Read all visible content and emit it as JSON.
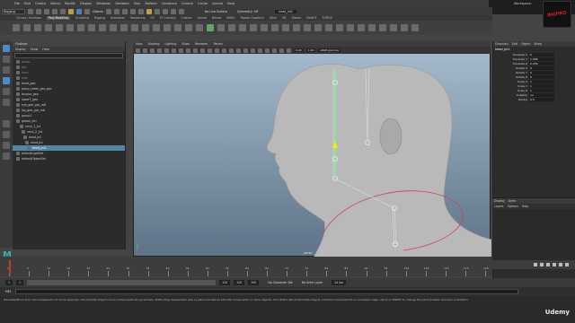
{
  "menu": [
    "File",
    "Edit",
    "Create",
    "Select",
    "Modify",
    "Display",
    "Windows",
    "Skeleton",
    "Skin",
    "Deform",
    "Constrain",
    "Control",
    "Cache",
    "Arnold",
    "Help"
  ],
  "status": {
    "mode": "Rigging",
    "objects_label": "Objects",
    "live_surface": "No Live Surface",
    "symmetry": "Symmetry: Off",
    "object_field": "head_jnt1",
    "workspace": "Workspace:"
  },
  "shelf_tabs": [
    "Curves / Surfaces",
    "Poly Modeling",
    "Sculpting",
    "Rigging",
    "Animation",
    "Rendering",
    "FX",
    "FX Caching",
    "Custom",
    "Arnold",
    "Bifrost",
    "MASH",
    "Motion Graphics",
    "XGen",
    "VR",
    "Stereo",
    "FieldFX",
    "TURTLE"
  ],
  "active_shelf_tab": "Poly Modeling",
  "outliner": {
    "title": "Outliner",
    "menu": [
      "Display",
      "Show",
      "Help"
    ],
    "rows": [
      {
        "label": "persp",
        "dim": true
      },
      {
        "label": "top",
        "dim": true
      },
      {
        "label": "front",
        "dim": true
      },
      {
        "label": "side",
        "dim": true
      },
      {
        "label": "head_geo",
        "dim": false
      },
      {
        "label": "proxy_teeth_geo_grp",
        "dim": false
      },
      {
        "label": "tongue_geo",
        "dim": false
      },
      {
        "label": "lowerT_geo",
        "dim": false
      },
      {
        "label": "eye_geo_grp_rotl",
        "dim": false
      },
      {
        "label": "lsg_geo_grp_rotl",
        "dim": false
      },
      {
        "label": "group1",
        "dim": false
      },
      {
        "label": "global_ctrl",
        "dim": false
      },
      {
        "label": "neck_1_jnt",
        "dim": false
      },
      {
        "label": "neck_2_jnt",
        "dim": false
      },
      {
        "label": "head_jnt",
        "dim": false
      },
      {
        "label": "head_jnt",
        "dim": false
      },
      {
        "label": "head_jnt1",
        "dim": false,
        "selected": true
      },
      {
        "label": "defaultLightSet",
        "dim": false
      },
      {
        "label": "defaultObjectSet",
        "dim": false
      }
    ]
  },
  "viewport": {
    "menu": [
      "View",
      "Shading",
      "Lighting",
      "Show",
      "Renderer",
      "Panels"
    ],
    "field_a": "0.00",
    "field_b": "1.00",
    "colorspace": "sRGB gamma",
    "camera": "persp"
  },
  "channel_box": {
    "tabs": [
      "Channels",
      "Edit",
      "Object",
      "Show"
    ],
    "object": "head_jnt1",
    "attributes": [
      {
        "name": "Translate X",
        "value": "0"
      },
      {
        "name": "Translate Y",
        "value": "1.589"
      },
      {
        "name": "Translate Z",
        "value": "0.256"
      },
      {
        "name": "Rotate X",
        "value": "0"
      },
      {
        "name": "Rotate Y",
        "value": "0"
      },
      {
        "name": "Rotate Z",
        "value": "0"
      },
      {
        "name": "Scale X",
        "value": "1"
      },
      {
        "name": "Scale Y",
        "value": "1"
      },
      {
        "name": "Scale Z",
        "value": "1"
      },
      {
        "name": "Visibility",
        "value": "on"
      },
      {
        "name": "Radius",
        "value": "0.5"
      }
    ],
    "layer_tabs": [
      "Display",
      "Anim"
    ],
    "layer_menu": [
      "Layers",
      "Options",
      "Help"
    ]
  },
  "timeline": {
    "ticks": [
      "1",
      "5",
      "10",
      "15",
      "20",
      "25",
      "30",
      "35",
      "40",
      "45",
      "50",
      "55",
      "60",
      "65",
      "70",
      "75",
      "80",
      "85",
      "90",
      "95",
      "100",
      "105",
      "110",
      "115",
      "120"
    ],
    "current_frame": "1"
  },
  "range": {
    "start": "1",
    "start2": "1",
    "end": "120",
    "end2": "120",
    "end3": "200",
    "character_set": "No Character Set",
    "anim_layer": "No Anim Layer",
    "fps": "24 fps"
  },
  "cmdline": {
    "label": "MEL"
  },
  "help": {
    "text": "Translate/Move Tool: Use manipulator to move object(s). Ctrl+middle-drag to move components along normals. Shift+drag manipulator axis or plane handles to extrude components or clone objects. Ctrl+Shift+left-click/middle-drag to constrain movement to a connected edge. Use D or INSERT to change the pivot position and axis orientation."
  },
  "badge": {
    "text": "Udemy"
  },
  "logo": {
    "text": "M"
  }
}
